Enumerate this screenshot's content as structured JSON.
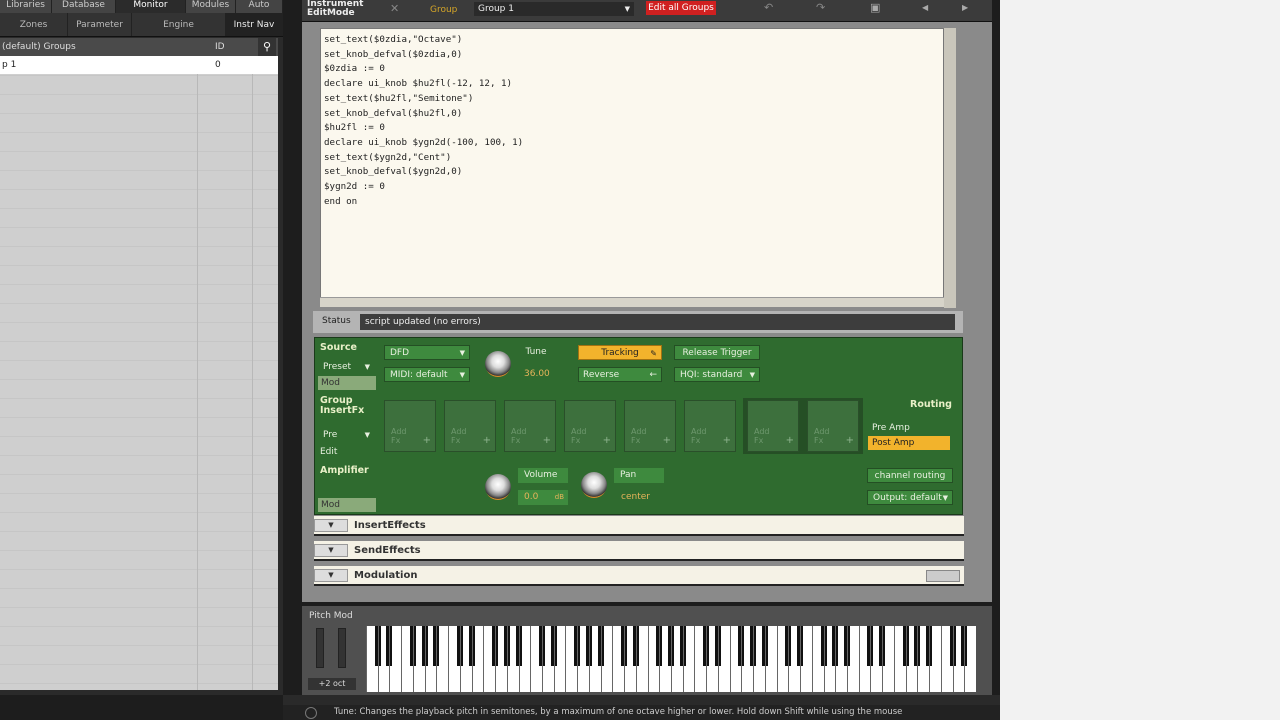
{
  "left_tabs": [
    "Libraries",
    "Database",
    "Monitor",
    "Modules",
    "Auto"
  ],
  "left_subtabs": [
    "Zones",
    "Parameter",
    "Engine",
    "Instr Nav"
  ],
  "groups_header": {
    "name": "(default) Groups",
    "id": "ID"
  },
  "groups_rows": [
    {
      "name": "p 1",
      "id": "0"
    }
  ],
  "topbar": {
    "title_line1": "Instrument",
    "title_line2": "EditMode",
    "group_label": "Group",
    "group_value": "Group 1",
    "edit_all": "Edit all Groups"
  },
  "code": "set_text($0zdia,\"Octave\")\nset_knob_defval($0zdia,0)\n$0zdia := 0\ndeclare ui_knob $hu2fl(-12, 12, 1)\nset_text($hu2fl,\"Semitone\")\nset_knob_defval($hu2fl,0)\n$hu2fl := 0\ndeclare ui_knob $ygn2d(-100, 100, 1)\nset_text($ygn2d,\"Cent\")\nset_knob_defval($ygn2d,0)\n$ygn2d := 0\nend on",
  "status": {
    "label": "Status",
    "text": "script updated (no errors)"
  },
  "source": {
    "title": "Source",
    "preset": "Preset",
    "mod": "Mod",
    "dfd": "DFD",
    "midi": "MIDI: default",
    "tune_label": "Tune",
    "tune_value": "36.00",
    "tracking": "Tracking",
    "reverse": "Reverse",
    "release": "Release Trigger",
    "hq": "HQI: standard"
  },
  "insertfx": {
    "title_line1": "Group",
    "title_line2": "InsertFx",
    "pre": "Pre",
    "edit": "Edit",
    "slot_line1": "Add",
    "slot_line2": "Fx",
    "routing": "Routing",
    "pre_amp": "Pre Amp",
    "post_amp": "Post Amp"
  },
  "amplifier": {
    "title": "Amplifier",
    "mod": "Mod",
    "volume_label": "Volume",
    "volume_value": "0.0",
    "volume_unit": "dB",
    "pan_label": "Pan",
    "pan_value": "center",
    "channel_routing": "channel routing",
    "output": "Output: default"
  },
  "sections": [
    "InsertEffects",
    "SendEffects",
    "Modulation"
  ],
  "keyboard": {
    "label": "Pitch Mod",
    "octave": "+2 oct"
  },
  "hint": "Tune: Changes the playback pitch in semitones, by a maximum of one octave higher or lower. Hold down Shift while using the mouse"
}
